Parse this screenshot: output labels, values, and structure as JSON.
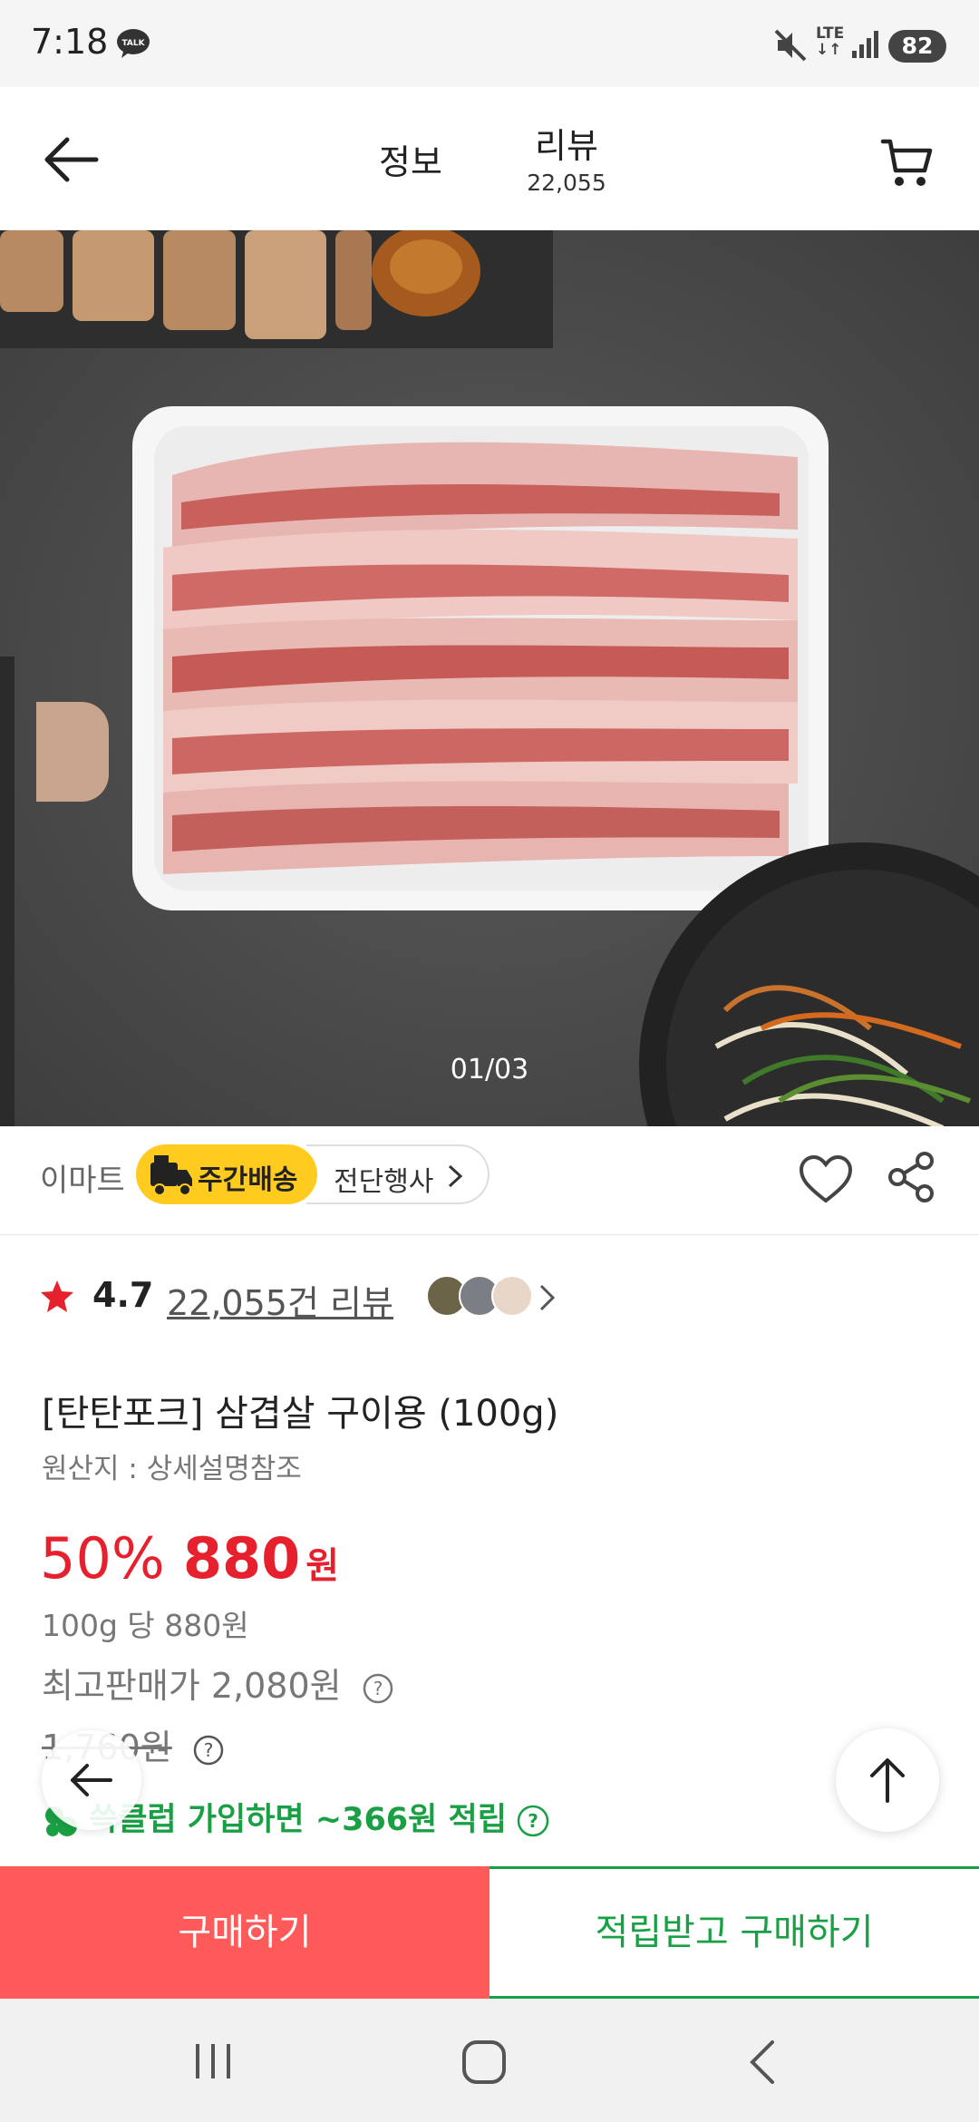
{
  "status_bar": {
    "time": "7:18",
    "network": "LTE",
    "battery": "82"
  },
  "header": {
    "tab_info": "정보",
    "tab_review": "리뷰",
    "review_count": "22,055"
  },
  "gallery": {
    "counter": "01/03"
  },
  "store": {
    "name": "이마트",
    "delivery_badge": "주간배송",
    "promo": "전단행사"
  },
  "rating": {
    "value": "4.7",
    "review_link": "22,055건 리뷰"
  },
  "product": {
    "title": "[탄탄포크] 삼겹살 구이용 (100g)",
    "origin": "원산지 : 상세설명참조"
  },
  "price": {
    "discount": "50%",
    "amount": "880",
    "currency": "원",
    "unit_price": "100g 당 880원",
    "max_price": "최고판매가 2,080원",
    "original_price": "1,760원"
  },
  "membership": {
    "text": "쓱클럽 가입하면 ~366원 적립",
    "color": "#1aa044"
  },
  "actions": {
    "buy": "구매하기",
    "reward_buy": "적립받고 구매하기"
  },
  "colors": {
    "sale_red": "#e7202d",
    "buy_button": "#ff5a5a",
    "delivery_yellow": "#ffcb1f",
    "accent_green": "#1aa044"
  }
}
